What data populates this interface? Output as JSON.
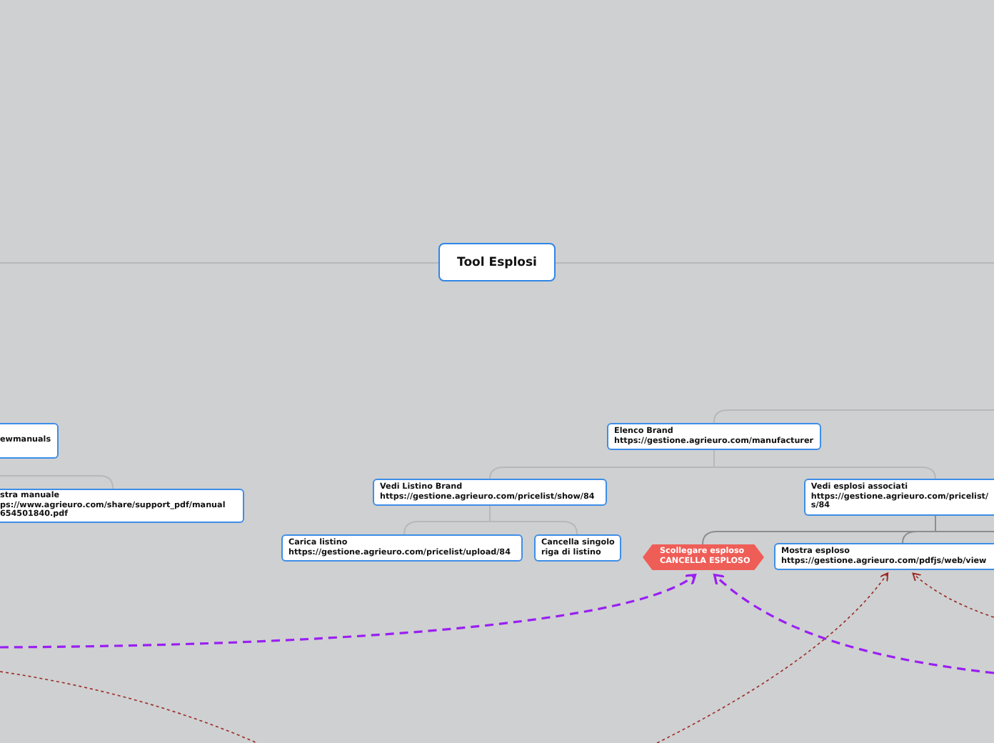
{
  "map": {
    "root": {
      "title": "Tool Esplosi"
    },
    "nodes": [
      {
        "kind": "box",
        "title": "ewmanuals"
      },
      {
        "kind": "box",
        "title": "stra manuale",
        "url": "ps://www.agrieuro.com/share/support_pdf/manual",
        "url_2": "654501840.pdf"
      },
      {
        "kind": "box",
        "title": "Elenco Brand",
        "url": "https://gestione.agrieuro.com/manufacturer"
      },
      {
        "kind": "box",
        "title": "Vedi Listino Brand",
        "url": "https://gestione.agrieuro.com/pricelist/show/84"
      },
      {
        "kind": "box",
        "title": "Carica listino",
        "url": "https://gestione.agrieuro.com/pricelist/upload/84"
      },
      {
        "kind": "box",
        "title": "Cancella singolo",
        "url": "riga di listino"
      },
      {
        "kind": "hexagon",
        "title": "Scollegare esploso",
        "url": "CANCELLA ESPLOSO"
      },
      {
        "kind": "box",
        "title": "Vedi esplosi associati",
        "url": "https://gestione.agrieuro.com/pricelist/",
        "url_2": "s/84"
      },
      {
        "kind": "box",
        "title": "Mostra esploso",
        "url": "https://gestione.agrieuro.com/pdfjs/web/view"
      }
    ]
  }
}
